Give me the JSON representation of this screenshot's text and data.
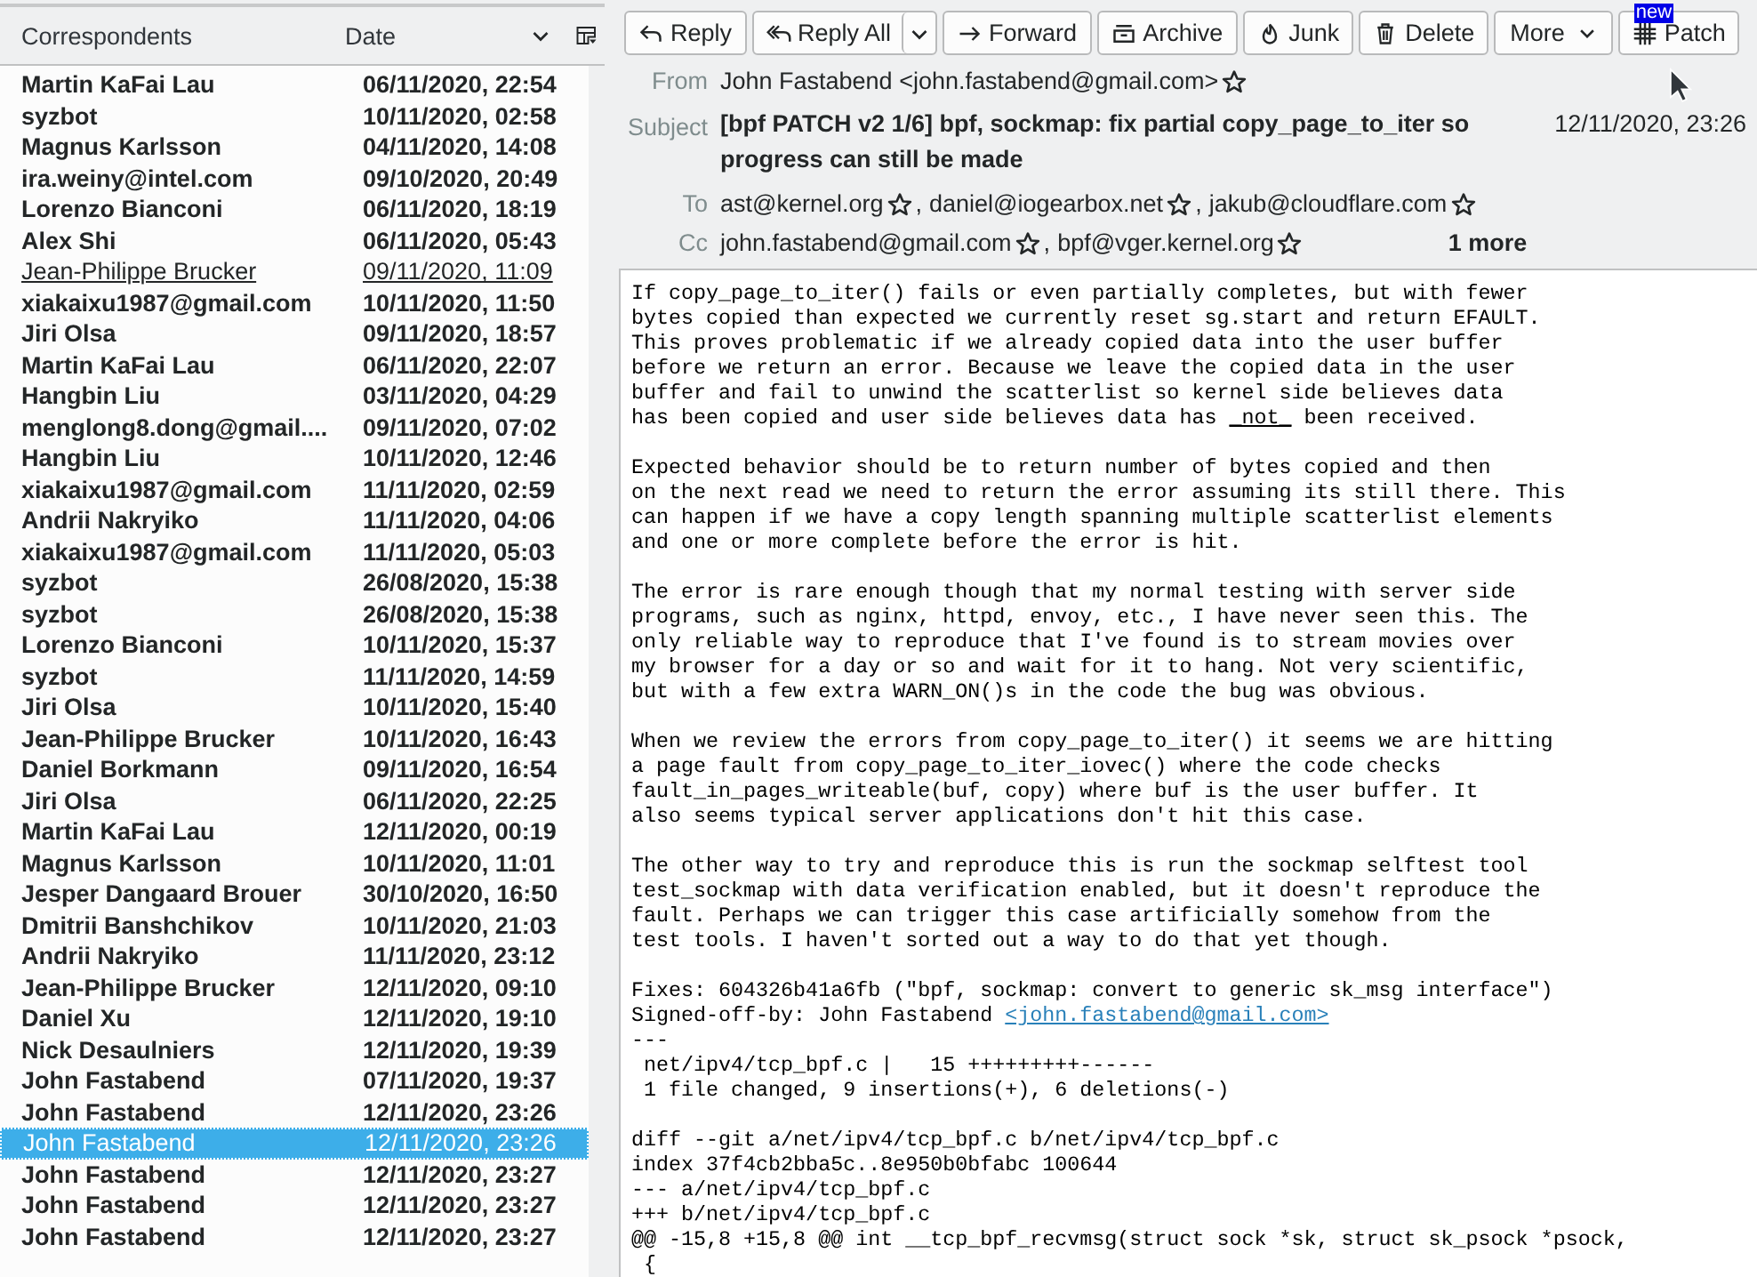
{
  "thread_list": {
    "columns": [
      {
        "label": "Correspondents"
      },
      {
        "label": "Date"
      }
    ],
    "rows": [
      {
        "name": "Martin KaFai Lau",
        "date": "06/11/2020, 22:54",
        "unread": true,
        "hovered": false,
        "selected": false
      },
      {
        "name": "syzbot",
        "date": "10/11/2020, 02:58",
        "unread": true,
        "hovered": false,
        "selected": false
      },
      {
        "name": "Magnus Karlsson",
        "date": "04/11/2020, 14:08",
        "unread": true,
        "hovered": false,
        "selected": false
      },
      {
        "name": "ira.weiny@intel.com",
        "date": "09/10/2020, 20:49",
        "unread": true,
        "hovered": false,
        "selected": false
      },
      {
        "name": "Lorenzo Bianconi",
        "date": "06/11/2020, 18:19",
        "unread": true,
        "hovered": false,
        "selected": false
      },
      {
        "name": "Alex Shi",
        "date": "06/11/2020, 05:43",
        "unread": true,
        "hovered": false,
        "selected": false
      },
      {
        "name": "Jean-Philippe Brucker",
        "date": "09/11/2020, 11:09",
        "unread": false,
        "hovered": true,
        "selected": false
      },
      {
        "name": "xiakaixu1987@gmail.com",
        "date": "10/11/2020, 11:50",
        "unread": true,
        "hovered": false,
        "selected": false
      },
      {
        "name": "Jiri Olsa",
        "date": "09/11/2020, 18:57",
        "unread": true,
        "hovered": false,
        "selected": false
      },
      {
        "name": "Martin KaFai Lau",
        "date": "06/11/2020, 22:07",
        "unread": true,
        "hovered": false,
        "selected": false
      },
      {
        "name": "Hangbin Liu",
        "date": "03/11/2020, 04:29",
        "unread": true,
        "hovered": false,
        "selected": false
      },
      {
        "name": "menglong8.dong@gmail....",
        "date": "09/11/2020, 07:02",
        "unread": true,
        "hovered": false,
        "selected": false
      },
      {
        "name": "Hangbin Liu",
        "date": "10/11/2020, 12:46",
        "unread": true,
        "hovered": false,
        "selected": false
      },
      {
        "name": "xiakaixu1987@gmail.com",
        "date": "11/11/2020, 02:59",
        "unread": true,
        "hovered": false,
        "selected": false
      },
      {
        "name": "Andrii Nakryiko",
        "date": "11/11/2020, 04:06",
        "unread": true,
        "hovered": false,
        "selected": false
      },
      {
        "name": "xiakaixu1987@gmail.com",
        "date": "11/11/2020, 05:03",
        "unread": true,
        "hovered": false,
        "selected": false
      },
      {
        "name": "syzbot",
        "date": "26/08/2020, 15:38",
        "unread": true,
        "hovered": false,
        "selected": false
      },
      {
        "name": "syzbot",
        "date": "26/08/2020, 15:38",
        "unread": true,
        "hovered": false,
        "selected": false
      },
      {
        "name": "Lorenzo Bianconi",
        "date": "10/11/2020, 15:37",
        "unread": true,
        "hovered": false,
        "selected": false
      },
      {
        "name": "syzbot",
        "date": "11/11/2020, 14:59",
        "unread": true,
        "hovered": false,
        "selected": false
      },
      {
        "name": "Jiri Olsa",
        "date": "10/11/2020, 15:40",
        "unread": true,
        "hovered": false,
        "selected": false
      },
      {
        "name": "Jean-Philippe Brucker",
        "date": "10/11/2020, 16:43",
        "unread": true,
        "hovered": false,
        "selected": false
      },
      {
        "name": "Daniel Borkmann",
        "date": "09/11/2020, 16:54",
        "unread": true,
        "hovered": false,
        "selected": false
      },
      {
        "name": "Jiri Olsa",
        "date": "06/11/2020, 22:25",
        "unread": true,
        "hovered": false,
        "selected": false
      },
      {
        "name": "Martin KaFai Lau",
        "date": "12/11/2020, 00:19",
        "unread": true,
        "hovered": false,
        "selected": false
      },
      {
        "name": "Magnus Karlsson",
        "date": "10/11/2020, 11:01",
        "unread": true,
        "hovered": false,
        "selected": false
      },
      {
        "name": "Jesper Dangaard Brouer",
        "date": "30/10/2020, 16:50",
        "unread": true,
        "hovered": false,
        "selected": false
      },
      {
        "name": "Dmitrii Banshchikov",
        "date": "10/11/2020, 21:03",
        "unread": true,
        "hovered": false,
        "selected": false
      },
      {
        "name": "Andrii Nakryiko",
        "date": "11/11/2020, 23:12",
        "unread": true,
        "hovered": false,
        "selected": false
      },
      {
        "name": "Jean-Philippe Brucker",
        "date": "12/11/2020, 09:10",
        "unread": true,
        "hovered": false,
        "selected": false
      },
      {
        "name": "Daniel Xu",
        "date": "12/11/2020, 19:10",
        "unread": true,
        "hovered": false,
        "selected": false
      },
      {
        "name": "Nick Desaulniers",
        "date": "12/11/2020, 19:39",
        "unread": true,
        "hovered": false,
        "selected": false
      },
      {
        "name": "John Fastabend",
        "date": "07/11/2020, 19:37",
        "unread": true,
        "hovered": false,
        "selected": false
      },
      {
        "name": "John Fastabend",
        "date": "12/11/2020, 23:26",
        "unread": true,
        "hovered": false,
        "selected": false
      },
      {
        "name": "John Fastabend",
        "date": "12/11/2020, 23:26",
        "unread": false,
        "hovered": false,
        "selected": true
      },
      {
        "name": "John Fastabend",
        "date": "12/11/2020, 23:27",
        "unread": true,
        "hovered": false,
        "selected": false
      },
      {
        "name": "John Fastabend",
        "date": "12/11/2020, 23:27",
        "unread": true,
        "hovered": false,
        "selected": false
      },
      {
        "name": "John Fastabend",
        "date": "12/11/2020, 23:27",
        "unread": true,
        "hovered": false,
        "selected": false
      }
    ]
  },
  "toolbar": [
    {
      "label": "Reply",
      "kind": "plain"
    },
    {
      "label": "Reply All",
      "kind": "split"
    },
    {
      "label": "Forward",
      "kind": "plain"
    },
    {
      "label": "Archive",
      "kind": "plain"
    },
    {
      "label": "Junk",
      "kind": "plain"
    },
    {
      "label": "Delete",
      "kind": "plain"
    },
    {
      "label": "More",
      "kind": "menu"
    },
    {
      "label": "Patch",
      "kind": "plain",
      "badge": "new"
    }
  ],
  "header": {
    "from": {
      "label": "From",
      "value": "John Fastabend <john.fastabend@gmail.com>"
    },
    "subject": {
      "label": "Subject",
      "value": "[bpf PATCH v2 1/6] bpf, sockmap: fix partial copy_page_to_iter so progress can still be made",
      "date": "12/11/2020, 23:26"
    },
    "to": {
      "label": "To",
      "separator": ",",
      "addresses": [
        "ast@kernel.org",
        "daniel@iogearbox.net",
        "jakub@cloudflare.com"
      ]
    },
    "cc": {
      "label": "Cc",
      "separator": ",",
      "addresses": [
        "john.fastabend@gmail.com",
        "bpf@vger.kernel.org"
      ],
      "more": "1 more"
    }
  },
  "body": [
    [
      "If copy_page_to_iter() fails or even partially completes, but with fewer",
      "bytes copied than expected we currently reset sg.start and return EFAULT.",
      "This proves problematic if we already copied data into the user buffer",
      "before we return an error. Because we leave the copied data in the user",
      "buffer and fail to unwind the scatterlist so kernel side believes data",
      [
        {
          "text": "has been copied and user side believes data has ",
          "kind": "plain"
        },
        {
          "text": "_not_",
          "kind": "underline"
        },
        {
          "text": " been received.",
          "kind": "plain"
        }
      ]
    ],
    [
      "Expected behavior should be to return number of bytes copied and then",
      "on the next read we need to return the error assuming its still there. This",
      "can happen if we have a copy length spanning multiple scatterlist elements",
      "and one or more complete before the error is hit."
    ],
    [
      "The error is rare enough though that my normal testing with server side",
      "programs, such as nginx, httpd, envoy, etc., I have never seen this. The",
      "only reliable way to reproduce that I've found is to stream movies over",
      "my browser for a day or so and wait for it to hang. Not very scientific,",
      "but with a few extra WARN_ON()s in the code the bug was obvious."
    ],
    [
      "When we review the errors from copy_page_to_iter() it seems we are hitting",
      "a page fault from copy_page_to_iter_iovec() where the code checks",
      "fault_in_pages_writeable(buf, copy) where buf is the user buffer. It",
      "also seems typical server applications don't hit this case."
    ],
    [
      "The other way to try and reproduce this is run the sockmap selftest tool",
      "test_sockmap with data verification enabled, but it doesn't reproduce the",
      "fault. Perhaps we can trigger this case artificially somehow from the",
      "test tools. I haven't sorted out a way to do that yet though."
    ],
    [
      "Fixes: 604326b41a6fb (\"bpf, sockmap: convert to generic sk_msg interface\")",
      [
        {
          "text": "Signed-off-by: John Fastabend ",
          "kind": "plain"
        },
        {
          "text": "<john.fastabend@gmail.com>",
          "kind": "link"
        }
      ],
      "---",
      " net/ipv4/tcp_bpf.c |   15 +++++++++------",
      " 1 file changed, 9 insertions(+), 6 deletions(-)"
    ],
    [
      "diff --git a/net/ipv4/tcp_bpf.c b/net/ipv4/tcp_bpf.c",
      "index 37f4cb2bba5c..8e950b0bfabc 100644",
      "--- a/net/ipv4/tcp_bpf.c",
      "+++ b/net/ipv4/tcp_bpf.c",
      "@@ -15,8 +15,8 @@ int __tcp_bpf_recvmsg(struct sock *sk, struct sk_psock *psock,",
      " {"
    ]
  ]
}
